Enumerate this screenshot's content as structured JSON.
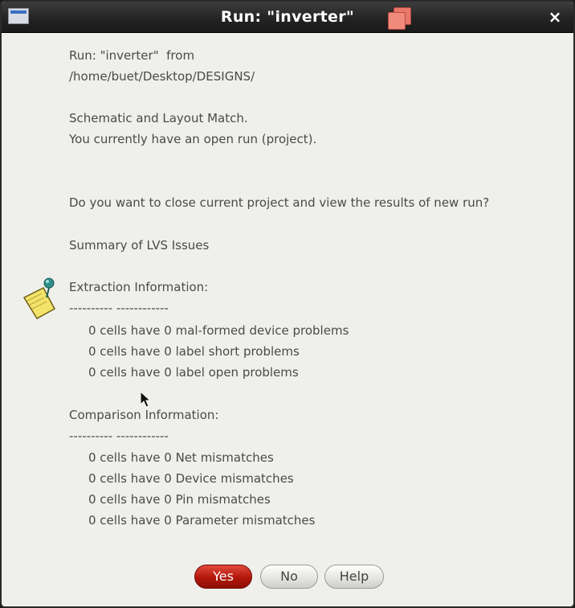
{
  "window": {
    "title": "Run: \"inverter\"",
    "close_glyph": "×",
    "menu_icon": "window-menu-icon",
    "app_icon": "run-app-icon"
  },
  "message": {
    "run_line": "Run: \"inverter\"  from",
    "path_line": "/home/buet/Desktop/DESIGNS/",
    "match_line": "Schematic and Layout Match.",
    "open_run_line": "You currently have an open run (project).",
    "question_line": "Do you want to close current project and view the results of new run?",
    "summary_heading": "Summary of LVS Issues"
  },
  "extraction": {
    "heading": "Extraction Information:",
    "separator": "---------- ------------",
    "lines": [
      "0 cells have 0 mal-formed device problems",
      "0 cells have 0 label short problems",
      "0 cells have 0 label open problems"
    ]
  },
  "comparison": {
    "heading": "Comparison Information:",
    "separator": "---------- ------------",
    "lines": [
      "0 cells have 0 Net mismatches",
      "0 cells have 0 Device mismatches",
      "0 cells have 0 Pin mismatches",
      "0 cells have 0 Parameter mismatches"
    ]
  },
  "buttons": {
    "yes": "Yes",
    "no": "No",
    "help": "Help"
  },
  "icons": {
    "note": "sticky-note-icon",
    "cursor": "mouse-cursor-icon"
  },
  "colors": {
    "titlebar": "#222222",
    "dialog_bg": "#efefec",
    "text": "#4a4a4a",
    "yes_button": "#b2160a"
  }
}
